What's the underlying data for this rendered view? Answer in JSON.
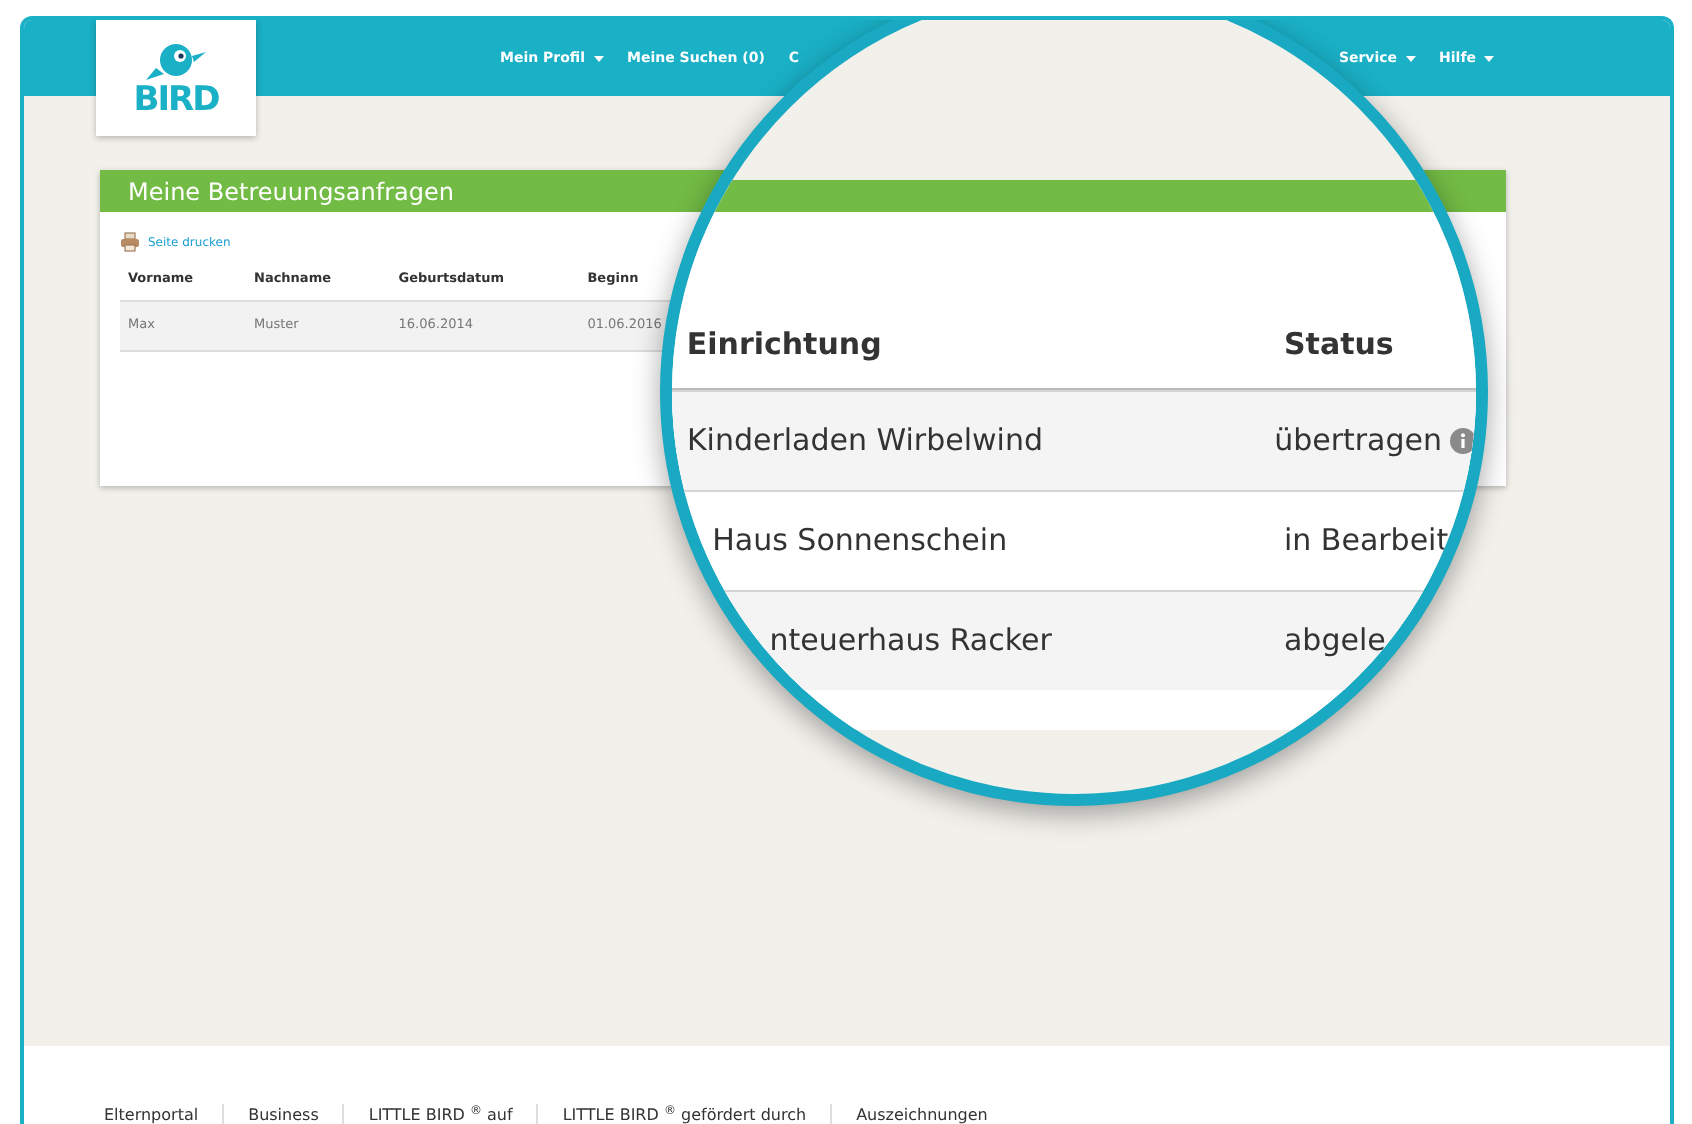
{
  "nav": {
    "logo_text": "BIRD",
    "items": [
      {
        "label": "Mein Profil",
        "dropdown": true
      },
      {
        "label": "Meine Suchen (0)",
        "dropdown": false
      },
      {
        "label": "C",
        "dropdown": false
      },
      {
        "label": "Service",
        "dropdown": true
      },
      {
        "label": "Hilfe",
        "dropdown": true
      }
    ]
  },
  "panel": {
    "title": "Meine Betreuungsanfragen",
    "print_link": "Seite drucken",
    "columns": [
      "Vorname",
      "Nachname",
      "Geburtsdatum",
      "Beginn"
    ],
    "rows": [
      [
        "Max",
        "Muster",
        "16.06.2014",
        "01.06.2016"
      ]
    ]
  },
  "magnifier": {
    "columns": [
      "Einrichtung",
      "Status"
    ],
    "rows": [
      {
        "cells": [
          "Kinderladen Wirbelwind",
          "übertragen"
        ],
        "info": true
      },
      {
        "cells": [
          "Haus Sonnenschein",
          "in Bearbeit"
        ],
        "info": false
      },
      {
        "cells": [
          "nteuerhaus Racker",
          "abgele"
        ],
        "info": false
      }
    ]
  },
  "footer": {
    "columns": [
      "Elternportal",
      "Business",
      "LITTLE BIRD $^{®}$ auf",
      "LITTLE BIRD $^{®}$ gefördert durch",
      "Auszeichnungen"
    ]
  }
}
